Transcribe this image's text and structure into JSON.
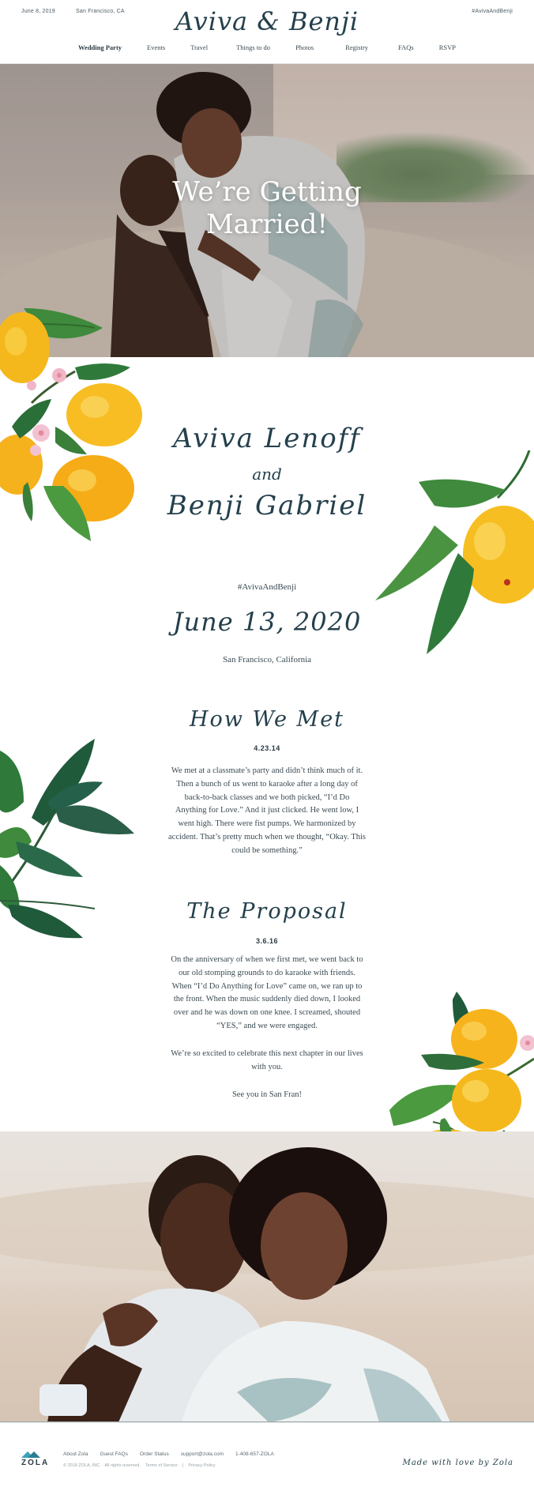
{
  "header": {
    "date": "June 8, 2019",
    "location": "San Francisco, CA",
    "hashtag": "#AvivaAndBenji",
    "logo": "Aviva & Benji"
  },
  "nav": [
    "Wedding Party",
    "Events",
    "Travel",
    "Things to do",
    "Photos",
    "Registry",
    "FAQs",
    "RSVP"
  ],
  "hero": {
    "title_line1": "We’re Getting",
    "title_line2": "Married!"
  },
  "couple": {
    "name1": "Aviva Lenoff",
    "and": "and",
    "name2": "Benji Gabriel",
    "hashtag": "#AvivaAndBenji",
    "date": "June 13, 2020",
    "location": "San Francisco, California"
  },
  "how_we_met": {
    "title": "How We Met",
    "date": "4.23.14",
    "text": "We met at a classmate’s party and didn’t think much of it. Then a bunch of us went to karaoke after a long day of back-to-back classes and we both picked, “I’d Do Anything for Love.” And it just clicked. He went low, I went high. There were fist pumps. We harmonized by accident. That’s pretty much when we thought, “Okay. This could be something.”"
  },
  "proposal": {
    "title": "The Proposal",
    "date": "3.6.16",
    "text": "On the anniversary of when we first met, we went back to our old stomping grounds to do karaoke with friends. When “I’d Do Anything for Love” came on, we ran up to the front. When the music suddenly died down, I looked over and he was down on one knee. I screamed, shouted “YES,” and we were engaged.",
    "text2": "We’re so excited to celebrate this next chapter in our lives with you.",
    "text3": "See you in San Fran!"
  },
  "footer": {
    "brand": "ZOLA",
    "links": [
      "About Zola",
      "Guest FAQs",
      "Order Status",
      "support@zola.com",
      "1-408-657-ZOLA"
    ],
    "copyright": "© 2018 ZOLA, INC. · All rights reserved.",
    "terms": "Terms of Service",
    "separator": "|",
    "privacy": "Privacy Policy",
    "made_with": "Made with love by Zola"
  },
  "colors": {
    "ink": "#24404c",
    "lemon": "#f5b81c",
    "leaf": "#3f8a3c",
    "leaf_dark": "#1f5a3a",
    "blossom": "#f0b6c8"
  }
}
